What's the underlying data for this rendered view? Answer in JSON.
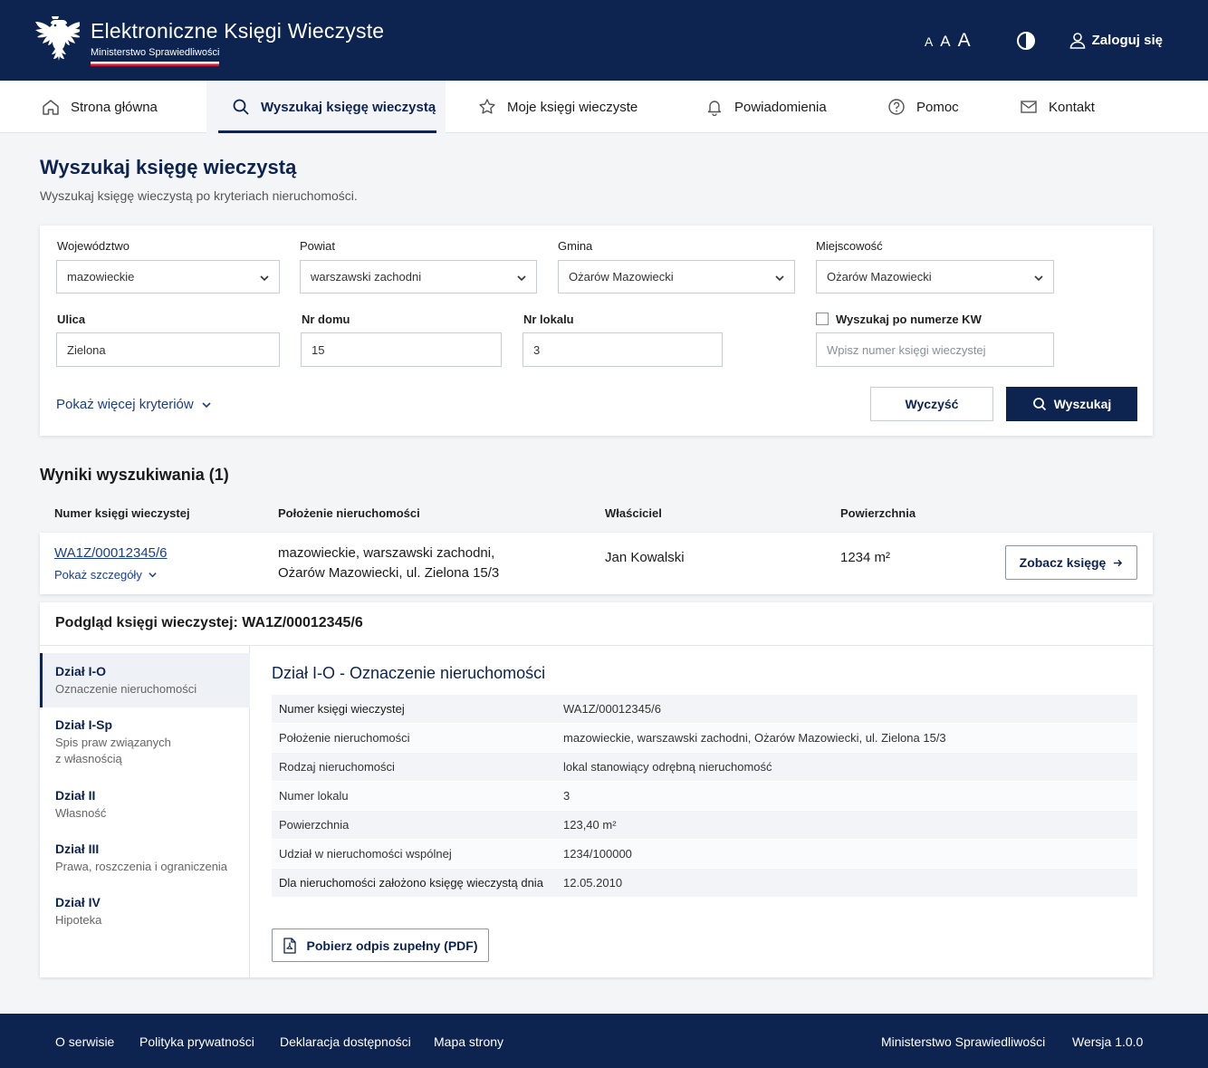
{
  "header": {
    "title": "Elektroniczne Księgi Wieczyste",
    "subtitle": "Ministerstwo Sprawiedliwości",
    "font_sizes": [
      "A",
      "A",
      "A"
    ],
    "login_label": "Zaloguj się"
  },
  "nav": {
    "items": [
      {
        "label": "Strona główna",
        "icon": "home-icon"
      },
      {
        "label": "Wyszukaj księgę wieczystą",
        "icon": "search-icon",
        "active": true
      },
      {
        "label": "Moje księgi wieczyste",
        "icon": "star-icon"
      },
      {
        "label": "Powiadomienia",
        "icon": "bell-icon"
      },
      {
        "label": "Pomoc",
        "icon": "help-icon"
      },
      {
        "label": "Kontakt",
        "icon": "mail-icon"
      }
    ]
  },
  "page": {
    "title": "Wyszukaj księgę wieczystą",
    "subtitle": "Wyszukaj księgę wieczystą po kryteriach nieruchomości."
  },
  "search": {
    "wojewodztwo": {
      "label": "Województwo",
      "value": "mazowieckie"
    },
    "powiat": {
      "label": "Powiat",
      "value": "warszawski zachodni"
    },
    "gmina": {
      "label": "Gmina",
      "value": "Ożarów Mazowiecki"
    },
    "miejscowosc": {
      "label": "Miejscowość",
      "value": "Ożarów Mazowiecki"
    },
    "ulica": {
      "label": "Ulica",
      "value": "Zielona"
    },
    "nr_domu": {
      "label": "Nr domu",
      "value": "15"
    },
    "nr_lokalu": {
      "label": "Nr lokalu",
      "value": "3"
    },
    "kw_checkbox_label": "Wyszukaj po numerze KW",
    "kw_placeholder": "Wpisz numer księgi wieczystej",
    "more_criteria": "Pokaż więcej kryteriów",
    "clear_label": "Wyczyść",
    "search_label": "Wyszukaj"
  },
  "results": {
    "title": "Wyniki wyszukiwania (1)",
    "columns": [
      "Numer księgi wieczystej",
      "Położenie nieruchomości",
      "Właściciel",
      "Powierzchnia"
    ],
    "row": {
      "number": "WA1Z/00012345/6",
      "details_link": "Pokaż szczegóły",
      "location_line1": "mazowieckie, warszawski zachodni,",
      "location_line2": "Ożarów Mazowiecki, ul. Zielona 15/3",
      "owner": "Jan Kowalski",
      "area": "1234 m²",
      "see_button": "Zobacz księgę"
    }
  },
  "preview": {
    "title": "Podgląd księgi wieczystej: WA1Z/00012345/6",
    "sections": [
      {
        "title": "Dział I-O",
        "desc1": "Oznaczenie nieruchomości",
        "desc2": ""
      },
      {
        "title": "Dział I-Sp",
        "desc1": "Spis praw związanych",
        "desc2": "z własnością"
      },
      {
        "title": "Dział II",
        "desc1": "Własność",
        "desc2": ""
      },
      {
        "title": "Dział III",
        "desc1": "Prawa, roszczenia i ograniczenia",
        "desc2": ""
      },
      {
        "title": "Dział IV",
        "desc1": "Hipoteka",
        "desc2": ""
      }
    ],
    "detail_title": "Dział I-O - Oznaczenie nieruchomości",
    "rows": [
      {
        "key": "Numer księgi wieczystej",
        "value": "WA1Z/00012345/6"
      },
      {
        "key": "Położenie nieruchomości",
        "value": "mazowieckie, warszawski zachodni, Ożarów Mazowiecki, ul. Zielona 15/3"
      },
      {
        "key": "Rodzaj nieruchomości",
        "value": "lokal stanowiący odrębną nieruchomość"
      },
      {
        "key": "Numer lokalu",
        "value": "3"
      },
      {
        "key": "Powierzchnia",
        "value": "123,40 m²"
      },
      {
        "key": "Udział w nieruchomości wspólnej",
        "value": "1234/100000"
      },
      {
        "key": "Dla nieruchomości założono księgę wieczystą dnia",
        "value": "12.05.2010"
      }
    ],
    "pdf_button": "Pobierz odpis zupełny (PDF)"
  },
  "footer": {
    "links": [
      "O serwisie",
      "Polityka prywatności",
      "Deklaracja dostępności",
      "Mapa strony"
    ],
    "ministry": "Ministerstwo Sprawiedliwości",
    "version": "Wersja 1.0.0"
  },
  "colors": {
    "primary": "#0d2350",
    "link": "#1a3d8f",
    "accent_red": "#dc143c"
  }
}
